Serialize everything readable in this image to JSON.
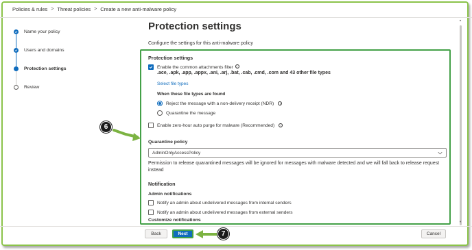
{
  "breadcrumb": [
    "Policies & rules",
    "Threat policies",
    "Create a new anti-malware policy"
  ],
  "breadcrumb_sep": ">",
  "steps": [
    {
      "label": "Name your policy",
      "state": "done"
    },
    {
      "label": "Users and domains",
      "state": "done"
    },
    {
      "label": "Protection settings",
      "state": "current"
    },
    {
      "label": "Review",
      "state": "pending"
    }
  ],
  "page": {
    "title": "Protection settings",
    "subtitle": "Configure the settings for this anti-malware policy"
  },
  "protection": {
    "heading": "Protection settings",
    "common_filter_label": "Enable the common attachments filter",
    "common_filter_checked": true,
    "file_types": ".ace, .apk, .app, .appx, .ani, .arj, .bat, .cab, .cmd, .com and 43 other file types",
    "select_file_types": "Select file types",
    "when_found_heading": "When these file types are found",
    "radio_reject": "Reject the message with a non-delivery receipt (NDR)",
    "radio_quarantine": "Quarantine the message",
    "selected_action": "reject",
    "zap_label": "Enable zero-hour auto purge for malware (Recommended)",
    "zap_checked": false
  },
  "quarantine": {
    "heading": "Quarantine policy",
    "selected": "AdminOnlyAccessPolicy",
    "note": "Permission to release quarantined messages will be ignored for messages with malware detected and we will fall back to release request instead"
  },
  "notification": {
    "heading": "Notification",
    "admin_heading": "Admin notifications",
    "internal_label": "Notify an admin about undelivered messages from internal senders",
    "external_label": "Notify an admin about undelivered messages from external senders",
    "customize_heading": "Customize notifications"
  },
  "buttons": {
    "back": "Back",
    "next": "Next",
    "cancel": "Cancel"
  },
  "annotations": {
    "callout_6": "6",
    "callout_7": "7"
  },
  "colors": {
    "accent": "#0f6cbd",
    "highlight": "#43a047",
    "arrow": "#7cb342"
  }
}
